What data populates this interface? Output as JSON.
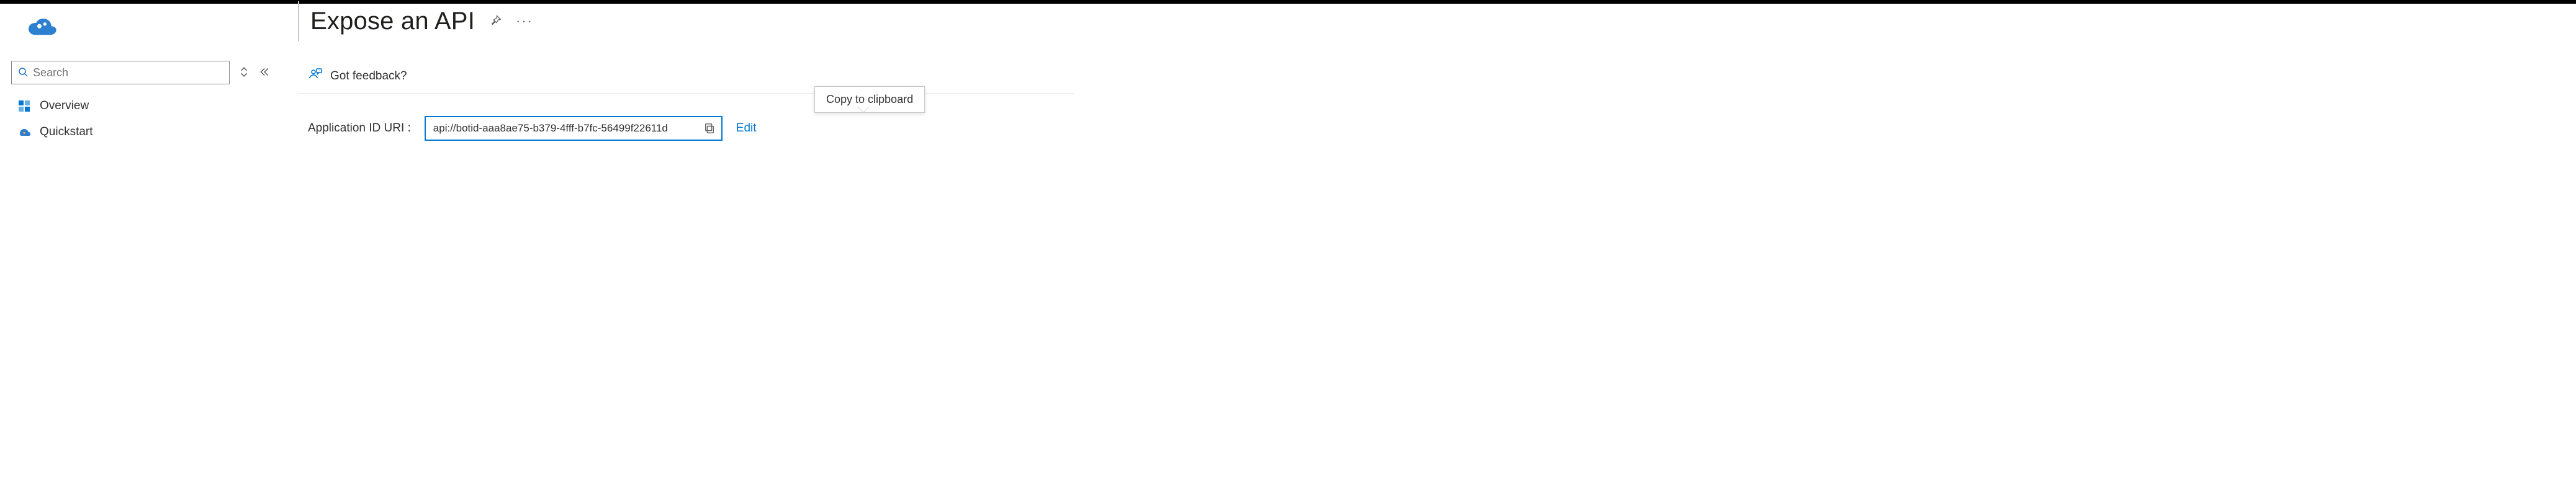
{
  "header": {
    "title": "Expose an API"
  },
  "search": {
    "placeholder": "Search"
  },
  "sidebar": {
    "items": [
      {
        "label": "Overview"
      },
      {
        "label": "Quickstart"
      }
    ]
  },
  "toolbar": {
    "feedback_label": "Got feedback?"
  },
  "main": {
    "uri_label": "Application ID URI :",
    "uri_value": "api://botid-aaa8ae75-b379-4fff-b7fc-56499f22611d",
    "edit_label": "Edit",
    "tooltip": "Copy to clipboard"
  }
}
